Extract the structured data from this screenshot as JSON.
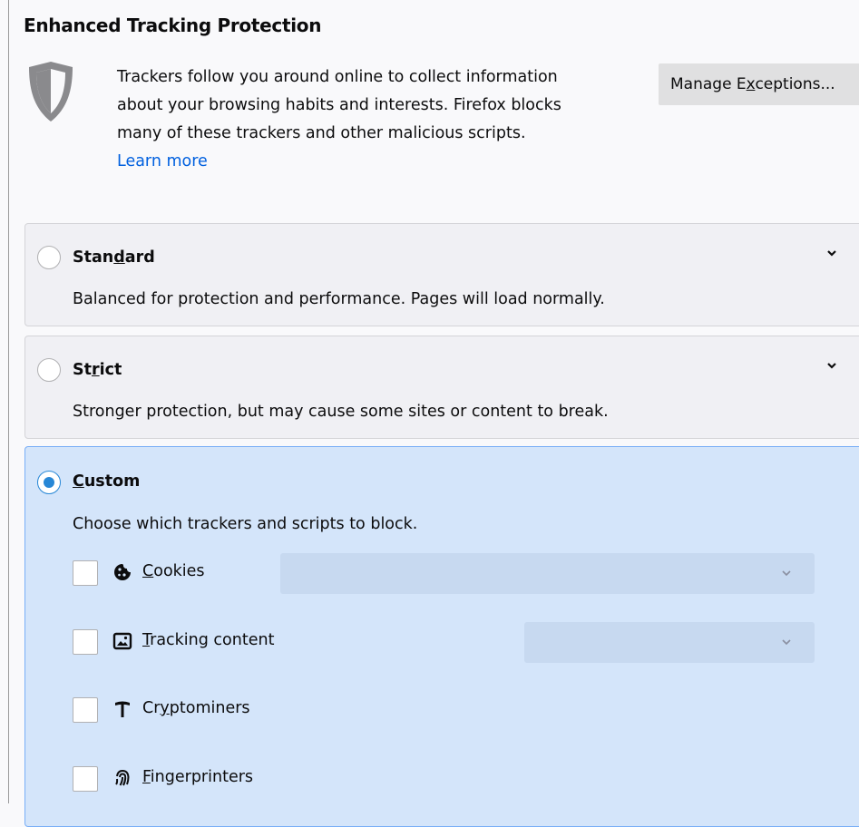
{
  "title": "Enhanced Tracking Protection",
  "intro": {
    "line1": "Trackers follow you around online to collect information",
    "line2": "about your browsing habits and interests. Firefox blocks",
    "line3": "many of these trackers and other malicious scripts.",
    "learn_more": "Learn more"
  },
  "manage_exceptions": {
    "label_pre": "Manage E",
    "label_key": "x",
    "label_post": "ceptions..."
  },
  "options": {
    "standard": {
      "title_pre": "Stan",
      "title_key": "d",
      "title_post": "ard",
      "desc": "Balanced for protection and performance. Pages will load normally.",
      "checked": false
    },
    "strict": {
      "title_pre": "St",
      "title_key": "r",
      "title_post": "ict",
      "desc": "Stronger protection, but may cause some sites or content to break.",
      "checked": false
    },
    "custom": {
      "title_pre": "",
      "title_key": "C",
      "title_post": "ustom",
      "desc": "Choose which trackers and scripts to block.",
      "checked": true,
      "controls": {
        "cookies": {
          "key": "C",
          "rest": "ookies",
          "icon": "cookie-icon",
          "checked": false
        },
        "tracking": {
          "key": "T",
          "rest": "racking content",
          "icon": "image-icon",
          "checked": false
        },
        "cryptominers": {
          "pre": "Cr",
          "key": "y",
          "rest": "ptominers",
          "icon": "pickaxe-icon",
          "checked": false
        },
        "fingerprinters": {
          "key": "F",
          "rest": "ingerprinters",
          "icon": "fingerprint-icon",
          "checked": false
        }
      }
    }
  },
  "colors": {
    "accent": "#2787d6",
    "link": "#0060df",
    "custom_bg": "#d4e5fa",
    "card_bg": "#f0f0f4"
  }
}
